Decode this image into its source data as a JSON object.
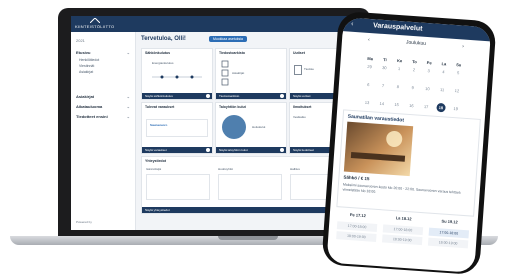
{
  "brand": {
    "name": "KIINTEISTÖLIITTO"
  },
  "sidebar": {
    "year": "2021",
    "groups": [
      {
        "label": "Etusivu",
        "subs": [
          "Henkilötiedot",
          "Viestinnät",
          "Asiakirjat"
        ]
      },
      {
        "label": "Asiakirjat",
        "subs": []
      },
      {
        "label": "Aikatauluoma",
        "subs": []
      },
      {
        "label": "Tiedotteet ensini",
        "subs": []
      }
    ],
    "powered": "Powered by"
  },
  "main": {
    "greeting": "Tervetuloa, Olli!",
    "edit_button": "Muokkaa asetuksia",
    "cards": {
      "energy": {
        "title": "Sähkönkulutus",
        "footer": "Näytä sähkönkulutus",
        "note": "Energiankulutus"
      },
      "docs": {
        "title": "Tiedostoarkisto",
        "footer": "Tiedostoarkisto",
        "note": "Asiakirjat"
      },
      "news": {
        "title": "Uutiset",
        "footer": "Näytä uutiset",
        "note": "Tiedote"
      },
      "booking": {
        "title": "Tulevat varaukset",
        "footer": "Näytä varaukset",
        "note": "Saunavuoro"
      },
      "pie": {
        "title": "Taloyhtiön kulut",
        "footer": "Näytä taloyhtiön kulut",
        "note": "Hoitokulut"
      },
      "bulletin": {
        "title": "Ilmoitukset",
        "footer": "Näytä tiedotteet",
        "note": "Vesikatko"
      },
      "contacts": {
        "title": "Yhteystiedot",
        "footer": "Näytä yhteystiedot",
        "cols": [
          "Isännöitsijä",
          "Huoltoyhtiö",
          "Hallitus"
        ]
      }
    }
  },
  "phone": {
    "back": "‹",
    "title": "Varauspalvelut",
    "month": "Joulukuu",
    "weekdays": [
      "Ma",
      "Ti",
      "Ke",
      "To",
      "Pe",
      "La",
      "Su"
    ],
    "days": [
      "29",
      "30",
      "1",
      "2",
      "3",
      "4",
      "5",
      "6",
      "7",
      "8",
      "9",
      "10",
      "11",
      "12",
      "13",
      "14",
      "15",
      "16",
      "17",
      "18",
      "19",
      "20",
      "21",
      "22",
      "23",
      "24",
      "25",
      "26",
      "27",
      "28",
      "29",
      "30",
      "31",
      "1",
      "2"
    ],
    "selected_day": "18",
    "service": {
      "title": "Saunatilan varaustiedot",
      "price": "Sähkö / € 15",
      "desc": "Maksiimi saunavuoron kesto klo 20:00 - 22:00. Saunavuoron varaus tehtävä viimeistään klo 18:00."
    },
    "dates": [
      {
        "head": "Pe 17.12",
        "slots": [
          "17:00-18:00",
          "18:00-19:00"
        ]
      },
      {
        "head": "La 18.12",
        "slots": [
          "17:00-18:00",
          "18:00-19:00"
        ]
      },
      {
        "head": "Su 19.12",
        "slots": [
          "17:00-18:00",
          "18:00-19:00"
        ]
      }
    ]
  },
  "colors": {
    "navy": "#1e3a5f",
    "accent": "#2c6db5",
    "bg": "#f2f4f7"
  }
}
